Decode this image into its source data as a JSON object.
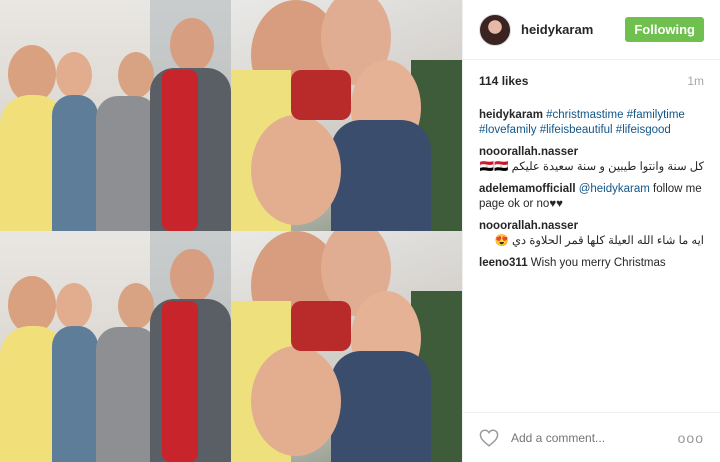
{
  "post": {
    "username": "heidykaram",
    "follow_label": "Following",
    "likes": "114 likes",
    "age": "1m"
  },
  "caption": {
    "username": "heidykaram",
    "tags": "#christmastime #familytime #lovefamily #lifeisbeautiful #lifeisgood"
  },
  "comments": [
    {
      "username": "nooorallah.nasser",
      "text": "كل سنة وانتوا طيبين و سنة سعيدة عليكم 🇪🇬🇪🇬"
    },
    {
      "username": "adelemamofficiall",
      "mention": "@heidykaram",
      "text": "follow me page ok or no♥♥"
    },
    {
      "username": "nooorallah.nasser",
      "text": "ايه ما شاء الله العيلة كلها قمر الحلاوة دي 😍"
    },
    {
      "username": "leeno311",
      "text": "Wish you merry Christmas"
    }
  ],
  "comment_box": {
    "placeholder": "Add a comment...",
    "more_label": "ooo"
  },
  "icons": {
    "heart": "heart-icon",
    "more": "more-options-icon"
  },
  "colors": {
    "follow_button": "#70c050",
    "link": "#125688",
    "muted": "#a5a7aa"
  }
}
